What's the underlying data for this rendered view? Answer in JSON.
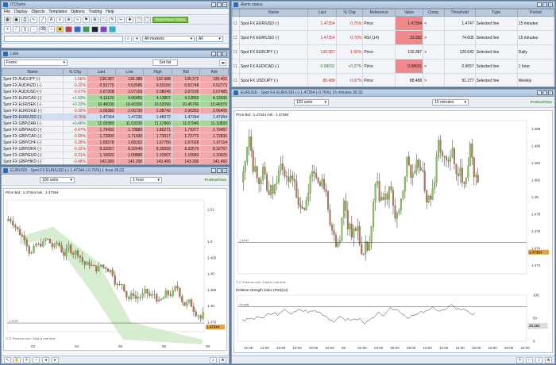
{
  "app": {
    "title": "ITCharts"
  },
  "menu": [
    "File",
    "Display",
    "Objects",
    "Templates",
    "Options",
    "Trading",
    "Help"
  ],
  "demo_button": "Demo/View Charts",
  "markets_select": "All markets",
  "all_select": "All",
  "lists": {
    "title": "Lists",
    "select": "Forex",
    "set_list": "Set list",
    "columns": [
      "Name",
      "% Chg",
      "Last",
      "Low",
      "High",
      "Bid",
      "Ask"
    ],
    "rows": [
      {
        "name": "Spot FX AUD/JPY (-)",
        "chg": "-1.58%",
        "last": "130.387",
        "low": "130.388",
        "high": "132.988",
        "bid": "130.372",
        "ask": "130.402",
        "dir": "neg",
        "sel": false
      },
      {
        "name": "Spot FX AUD/NZD (-)",
        "chg": "-0.32%",
        "last": "0.52775",
        "low": "0.52685",
        "high": "0.53150",
        "bid": "0.52748",
        "ask": "0.52773",
        "dir": "neg",
        "sel": false
      },
      {
        "name": "Spot FX AUD/USD (-)",
        "chg": "-0.07%",
        "last": "2.07308",
        "low": "2.07103",
        "high": "2.08040",
        "bid": "2.07235",
        "ask": "2.07485",
        "dir": "neg",
        "sel": false
      },
      {
        "name": "Spot FX EUR/CAD (-)",
        "chg": "+1.93%",
        "last": "4.13120",
        "low": "4.06455",
        "high": "4.13807",
        "bid": "4.12860",
        "ask": "4.13430",
        "dir": "pos",
        "sel": false
      },
      {
        "name": "Spot FX EUR/SEK (-)",
        "chg": "+0.32%",
        "last": "10.46030",
        "low": "10.42300",
        "high": "10.52090",
        "bid": "10.45780",
        "ask": "10.46370",
        "dir": "pos",
        "sel": false
      },
      {
        "name": "Spot FX EUR/SGD (-)",
        "chg": "-0.39%",
        "last": "2.06380",
        "low": "2.05730",
        "high": "2.08742",
        "bid": "2.06353",
        "ask": "2.06405",
        "dir": "neg",
        "sel": false
      },
      {
        "name": "Spot FX EUR/USD (-)",
        "chg": "-0.76%",
        "last": "1.47344",
        "low": "1.47235",
        "high": "1.48072",
        "bid": "1.47344",
        "ask": "1.47364",
        "dir": "neg",
        "sel": true
      },
      {
        "name": "Spot FX GBP/ZAR (-)",
        "chg": "+0.46%",
        "last": "11.09380",
        "low": "11.03330",
        "high": "11.17860",
        "bid": "11.07940",
        "ask": "11.10820",
        "dir": "pos",
        "sel": false
      },
      {
        "name": "Spot FX GBP/AUD (-)",
        "chg": "-0.47%",
        "last": "1.79432",
        "low": "1.78880",
        "high": "1.80271",
        "bid": "1.79377",
        "ask": "1.79487",
        "dir": "neg",
        "sel": false
      },
      {
        "name": "Spot FX GBP/CAD (-)",
        "chg": "-0.09%",
        "last": "1.72800",
        "low": "1.71430",
        "high": "1.73017",
        "bid": "1.72770",
        "ask": "1.72830",
        "dir": "neg",
        "sel": false
      },
      {
        "name": "Spot FX GBP/CHF (-)",
        "chg": "-0.38%",
        "last": "1.68378",
        "low": "1.68152",
        "high": "1.67750",
        "bid": "1.67028",
        "ask": "1.67114",
        "dir": "neg",
        "sel": false
      },
      {
        "name": "Spot FX GBP/DKK (-)",
        "chg": "-0.32%",
        "last": "8.32667",
        "low": "8.32640",
        "high": "8.35650",
        "bid": "8.32570",
        "ask": "8.32767",
        "dir": "neg",
        "sel": false
      },
      {
        "name": "Spot FX GBP/EUR (-)",
        "chg": "-0.31%",
        "last": "1.10602",
        "low": "1.09889",
        "high": "1.10507",
        "bid": "1.10583",
        "ask": "1.10620",
        "dir": "neg",
        "sel": false
      },
      {
        "name": "Spot FX GBP/HKD (-)",
        "chg": "-0.48%",
        "last": "143.380",
        "low": "143.200",
        "high": "143.490",
        "bid": "143.300",
        "ask": "143.460",
        "dir": "neg",
        "sel": false
      },
      {
        "name": "Spot FX GBP/JPY (-)",
        "chg": "-1.17%",
        "last": "144.213",
        "low": "143.816",
        "high": "147.028",
        "bid": "144.197",
        "ask": "144.229",
        "dir": "neg",
        "sel": false
      }
    ]
  },
  "alerts": {
    "title": "Alerts status",
    "columns": [
      "Name",
      "Last",
      "% Chg",
      "Reference",
      "Value",
      "Comp.",
      "Threshold",
      "Type",
      "Period"
    ],
    "rows": [
      {
        "name": "Spot FX EUR/USD (-)",
        "last": "1.47354",
        "chg": "-0.75%",
        "ref": "Price",
        "value": "1.47354",
        "comp": "<",
        "threshold": "1.4747",
        "type": "Selected line",
        "period": "15 minutes",
        "vstyle": "neg"
      },
      {
        "name": "Spot FX EUR/USD (-)",
        "last": "1.47354",
        "chg": "-0.70%",
        "ref": "RSI (14)",
        "value": "33.282",
        "comp": ">",
        "threshold": "74.605",
        "type": "Selected line",
        "period": "15 minutes",
        "vstyle": "neg"
      },
      {
        "name": "Spot FX EUR/JPY (-)",
        "last": "130.387",
        "chg": "-1.66%",
        "ref": "Price",
        "value": "130.387",
        "comp": ">",
        "threshold": "120.642",
        "type": "Selected line",
        "period": "Daily",
        "vstyle": "none"
      },
      {
        "name": "Spot FX AUD/CAD (-)",
        "last": "0.98031",
        "chg": "+0.27%",
        "ref": "Price",
        "value": "0.98031",
        "comp": "<",
        "threshold": "0.9657",
        "type": "Selected line",
        "period": "1 hour",
        "vstyle": "neg"
      },
      {
        "name": "Spot FX USD/JPY (-)",
        "last": "88.488",
        "chg": "-0.97%",
        "ref": "Price",
        "value": "88.488",
        "comp": ">",
        "threshold": "91.277",
        "type": "Selected line",
        "period": "Weekly",
        "vstyle": "none"
      }
    ]
  },
  "chart_small": {
    "title": "EURUSD - Spot FX EUR/USD (-) 1.47344 (-0.76%) 1 hour 26:32",
    "units": "100 units",
    "period": "1 hour",
    "legend": "Price  Bid : 1.47344  Ask : 1.47364",
    "watermark": "ProRealTime",
    "copyright": "© IT-Finance.com. Data is real time",
    "price_tag": "1.47344",
    "hline_label": "1.4747",
    "yticks": [
      "1.51",
      "1.5",
      "1.495",
      "1.49",
      "1.485",
      "1.48",
      "1.475"
    ],
    "xticks": [
      "03",
      "04",
      "05",
      "06",
      "08"
    ]
  },
  "chart_big": {
    "title": "EURUSD - Spot FX EUR/USD (-) 1.47354 (-0.76%) 15 minutes 26:32",
    "units": "120 units",
    "period": "15 minutes",
    "legend": "Price  Bid : 1.47344  Ask : 1.47364",
    "watermark": "ProRealTime",
    "copyright": "© IT-Finance.com. Data is real time",
    "price_tag": "1.47354",
    "hline_label": "1.4747",
    "yticks": [
      "1.488",
      "1.486",
      "1.484",
      "1.482",
      "1.48",
      "1.478",
      "1.476",
      "1.474",
      "1.472"
    ],
    "xticks": [
      "12:00",
      "14:00",
      "16:00",
      "18:00",
      "20:00",
      "22:00",
      "08",
      "02:00",
      "04:00",
      "06:00",
      "08:00",
      "10:00",
      "12:00",
      "14:00",
      "16:00",
      "18:00",
      "20:00",
      "22:00"
    ],
    "rsi_title": "Relative strength index (RSI)(14)",
    "rsi_value": "74.605",
    "rsi_tag": "33.282",
    "rsi_yticks": [
      "100",
      "50",
      "0"
    ]
  }
}
